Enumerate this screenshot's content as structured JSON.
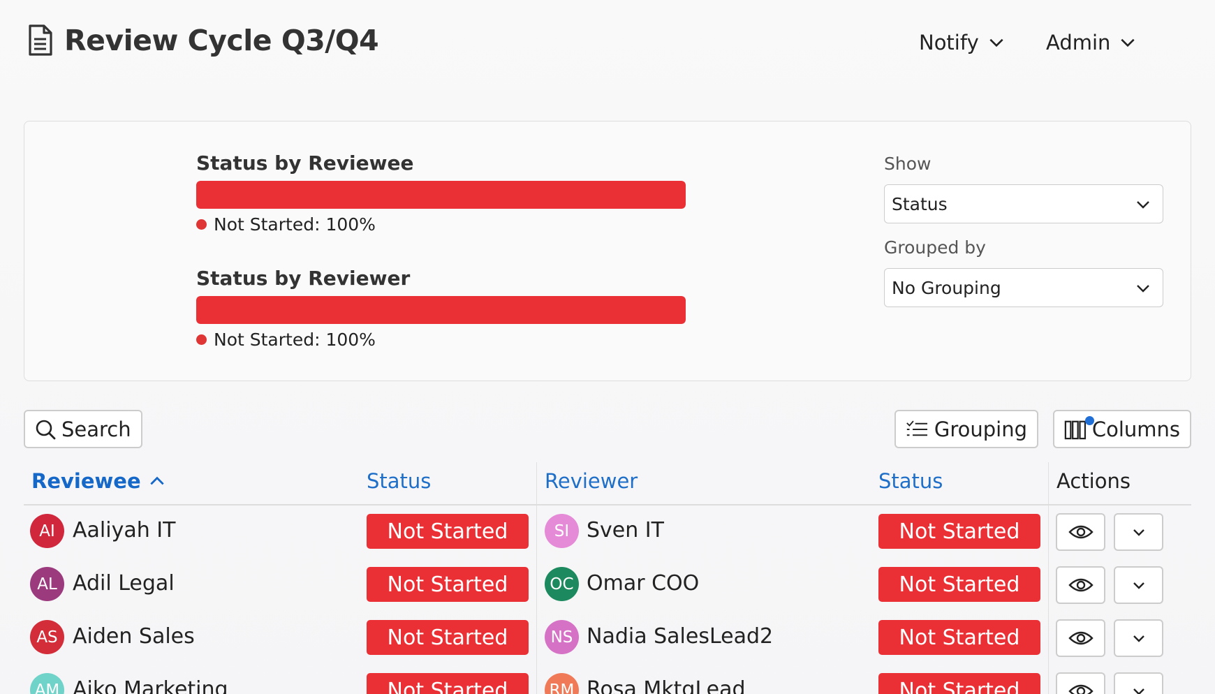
{
  "header": {
    "title": "Review Cycle Q3/Q4",
    "notify_label": "Notify",
    "admin_label": "Admin"
  },
  "summary": {
    "reviewee": {
      "title": "Status by Reviewee",
      "legend_label": "Not Started",
      "legend_value": "100%",
      "fill_percent": 100
    },
    "reviewer": {
      "title": "Status by Reviewer",
      "legend_label": "Not Started",
      "legend_value": "100%",
      "fill_percent": 100
    },
    "show_label": "Show",
    "show_value": "Status",
    "grouped_by_label": "Grouped by",
    "grouped_by_value": "No Grouping"
  },
  "toolbar": {
    "search_label": "Search",
    "grouping_label": "Grouping",
    "columns_label": "Columns"
  },
  "table": {
    "columns": {
      "reviewee": "Reviewee",
      "reviewee_status": "Status",
      "reviewer": "Reviewer",
      "reviewer_status": "Status",
      "actions": "Actions"
    },
    "rows": [
      {
        "reviewee": {
          "initials": "AI",
          "name": "Aaliyah IT",
          "color": "#d0273d"
        },
        "reviewee_status": "Not Started",
        "reviewer": {
          "initials": "SI",
          "name": "Sven IT",
          "color": "#e58ad6"
        },
        "reviewer_status": "Not Started"
      },
      {
        "reviewee": {
          "initials": "AL",
          "name": "Adil Legal",
          "color": "#9c3a7e"
        },
        "reviewee_status": "Not Started",
        "reviewer": {
          "initials": "OC",
          "name": "Omar COO",
          "color": "#1c8a5e"
        },
        "reviewer_status": "Not Started"
      },
      {
        "reviewee": {
          "initials": "AS",
          "name": "Aiden Sales",
          "color": "#d42d3a"
        },
        "reviewee_status": "Not Started",
        "reviewer": {
          "initials": "NS",
          "name": "Nadia SalesLead2",
          "color": "#d672c6"
        },
        "reviewer_status": "Not Started"
      },
      {
        "reviewee": {
          "initials": "AM",
          "name": "Aiko Marketing",
          "color": "#6fd3c9"
        },
        "reviewee_status": "Not Started",
        "reviewer": {
          "initials": "RM",
          "name": "Rosa MktgLead",
          "color": "#f07a58"
        },
        "reviewer_status": "Not Started"
      }
    ]
  },
  "icons": {
    "title": "document-icon",
    "dropdown": "chevron-down-icon",
    "search": "search-icon",
    "grouping": "grouping-list-icon",
    "columns": "columns-icon",
    "sort": "chevron-up-icon",
    "view": "eye-icon"
  },
  "colors": {
    "accent": "#1f6fc9",
    "not_started": "#ea3035"
  }
}
